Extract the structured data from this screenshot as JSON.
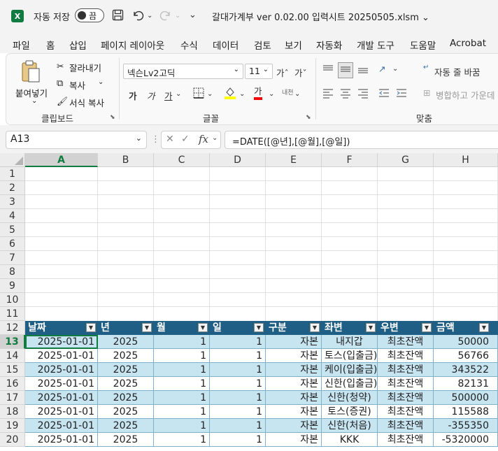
{
  "titlebar": {
    "app_logo": "X",
    "autosave_label": "자동 저장",
    "autosave_state": "끔",
    "document_title": "갈대가계부 ver 0.02.00 입력시트 20250505.xlsm",
    "title_caret": "⌄"
  },
  "menu": [
    "파일",
    "홈",
    "삽입",
    "페이지 레이아웃",
    "수식",
    "데이터",
    "검토",
    "보기",
    "자동화",
    "개발 도구",
    "도움말",
    "Acrobat"
  ],
  "ribbon": {
    "clipboard": {
      "paste": "붙여넣기",
      "cut": "잘라내기",
      "copy": "복사",
      "format_painter": "서식 복사",
      "label": "클립보드"
    },
    "font": {
      "font_name": "넥슨Lv2고딕",
      "font_size": "11",
      "increase": "가ˆ",
      "decrease": "가ˇ",
      "bold": "가",
      "italic": "가",
      "underline": "가",
      "font_color_glyph": "가",
      "phonetic": "내천",
      "label": "글꼴"
    },
    "align": {
      "wrap_text": "자동 줄 바꿈",
      "merge": "병합하고 가운데",
      "label": "맞춤"
    }
  },
  "formula_bar": {
    "name_box": "A13",
    "formula": "=DATE([@년],[@월],[@일])"
  },
  "columns": [
    "A",
    "B",
    "C",
    "D",
    "E",
    "F",
    "G",
    "H"
  ],
  "empty_rows": [
    "1",
    "2",
    "3",
    "4",
    "5",
    "6",
    "7",
    "8",
    "9",
    "10",
    "11"
  ],
  "table": {
    "header_row": "12",
    "headers": [
      "날짜",
      "년",
      "월",
      "일",
      "구분",
      "좌변",
      "우변",
      "금액"
    ],
    "rows": [
      {
        "row": "13",
        "cells": [
          "2025-01-01",
          "2025",
          "1",
          "1",
          "자본",
          "내지갑",
          "최초잔액",
          "50000"
        ]
      },
      {
        "row": "14",
        "cells": [
          "2025-01-01",
          "2025",
          "1",
          "1",
          "자본",
          "토스(입출금)",
          "최초잔액",
          "56766"
        ]
      },
      {
        "row": "15",
        "cells": [
          "2025-01-01",
          "2025",
          "1",
          "1",
          "자본",
          "케이(입출금)",
          "최초잔액",
          "343522"
        ]
      },
      {
        "row": "16",
        "cells": [
          "2025-01-01",
          "2025",
          "1",
          "1",
          "자본",
          "신한(입출금)",
          "최초잔액",
          "82131"
        ]
      },
      {
        "row": "17",
        "cells": [
          "2025-01-01",
          "2025",
          "1",
          "1",
          "자본",
          "신한(청약)",
          "최초잔액",
          "500000"
        ]
      },
      {
        "row": "18",
        "cells": [
          "2025-01-01",
          "2025",
          "1",
          "1",
          "자본",
          "토스(증권)",
          "최초잔액",
          "115588"
        ]
      },
      {
        "row": "19",
        "cells": [
          "2025-01-01",
          "2025",
          "1",
          "1",
          "자본",
          "신한(처음)",
          "최초잔액",
          "-355350"
        ]
      },
      {
        "row": "20",
        "cells": [
          "2025-01-01",
          "2025",
          "1",
          "1",
          "자본",
          "KKK",
          "최초잔액",
          "-5320000"
        ]
      }
    ]
  },
  "colors": {
    "excel_green": "#107c41",
    "table_header": "#1f5f86",
    "band_light": "#c7e4f1"
  }
}
